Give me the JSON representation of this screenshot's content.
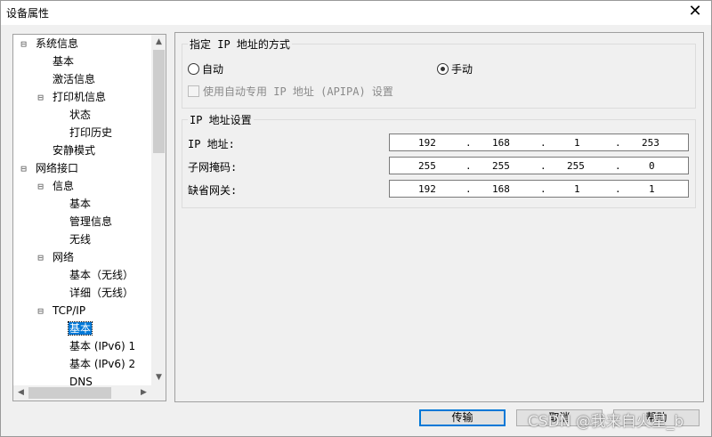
{
  "window": {
    "title": "设备属性",
    "close_glyph": "✕"
  },
  "tree": {
    "items": [
      {
        "label": "系统信息",
        "expander": "⊟"
      },
      {
        "label": "基本"
      },
      {
        "label": "激活信息"
      },
      {
        "label": "打印机信息",
        "expander": "⊟"
      },
      {
        "label": "状态"
      },
      {
        "label": "打印历史"
      },
      {
        "label": "安静模式"
      },
      {
        "label": "网络接口",
        "expander": "⊟"
      },
      {
        "label": "信息",
        "expander": "⊟"
      },
      {
        "label": "基本"
      },
      {
        "label": "管理信息"
      },
      {
        "label": "无线"
      },
      {
        "label": "网络",
        "expander": "⊟"
      },
      {
        "label": "基本（无线）"
      },
      {
        "label": "详细（无线）"
      },
      {
        "label": "TCP/IP",
        "expander": "⊟"
      },
      {
        "label": "基本",
        "selected": true
      },
      {
        "label": "基本 (IPv6) 1"
      },
      {
        "label": "基本 (IPv6) 2"
      },
      {
        "label": "DNS"
      }
    ],
    "scroll_up": "▲",
    "scroll_down": "▼",
    "scroll_left": "◀",
    "scroll_right": "▶"
  },
  "ip_method": {
    "title": "指定 IP 地址的方式",
    "auto_label": "自动",
    "manual_label": "手动",
    "selected": "manual",
    "apipa_label": "使用自动专用 IP 地址 (APIPA) 设置",
    "apipa_checked": false
  },
  "ip_settings": {
    "title": "IP 地址设置",
    "rows": [
      {
        "label": "IP 地址:",
        "octets": [
          "192",
          "168",
          "1",
          "253"
        ]
      },
      {
        "label": "子网掩码:",
        "octets": [
          "255",
          "255",
          "255",
          "0"
        ]
      },
      {
        "label": "缺省网关:",
        "octets": [
          "192",
          "168",
          "1",
          "1"
        ]
      }
    ],
    "dot": "."
  },
  "buttons": {
    "transmit": "传输",
    "cancel": "取消",
    "help": "帮助"
  },
  "watermark": "CSDN @我来自火星_b"
}
